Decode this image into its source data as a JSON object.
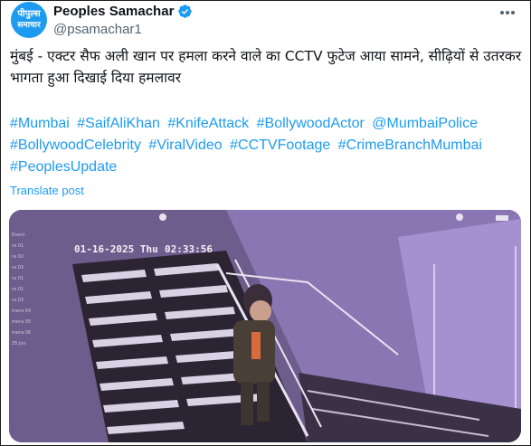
{
  "header": {
    "avatar_line1": "पीपुल्स",
    "avatar_line2": "समाचार",
    "display_name": "Peoples Samachar",
    "handle": "@psamachar1"
  },
  "post": {
    "text": "मुंबई - एक्टर सैफ अली खान पर हमला करने वाले का CCTV फुटेज आया सामने, सीढ़ियों से उतरकर भागता हुआ दिखाई दिया हमलावर",
    "hashtags": [
      "#Mumbai",
      "#SaifAliKhan",
      "#KnifeAttack",
      "#BollywoodActor",
      "@MumbaiPolice",
      "#BollywoodCelebrity",
      "#ViralVideo",
      "#CCTVFootage",
      "#CrimeBranchMumbai",
      "#PeoplesUpdate"
    ],
    "translate_label": "Translate post"
  },
  "media": {
    "date": "01-16-2025",
    "day": "Thu",
    "time": "02:33:56",
    "side_menu": [
      "Event",
      "ra 01",
      "ra 02",
      "ra 03",
      "ra 01",
      "ra 01",
      "ra 03",
      "mera 04",
      "mera 05",
      "mera 06",
      "25 Jun"
    ]
  },
  "colors": {
    "link": "#1d9bf0",
    "text": "#0f1419",
    "secondary": "#536471"
  },
  "icons": {
    "verified": "verified-badge-icon",
    "more": "more-options-icon"
  }
}
